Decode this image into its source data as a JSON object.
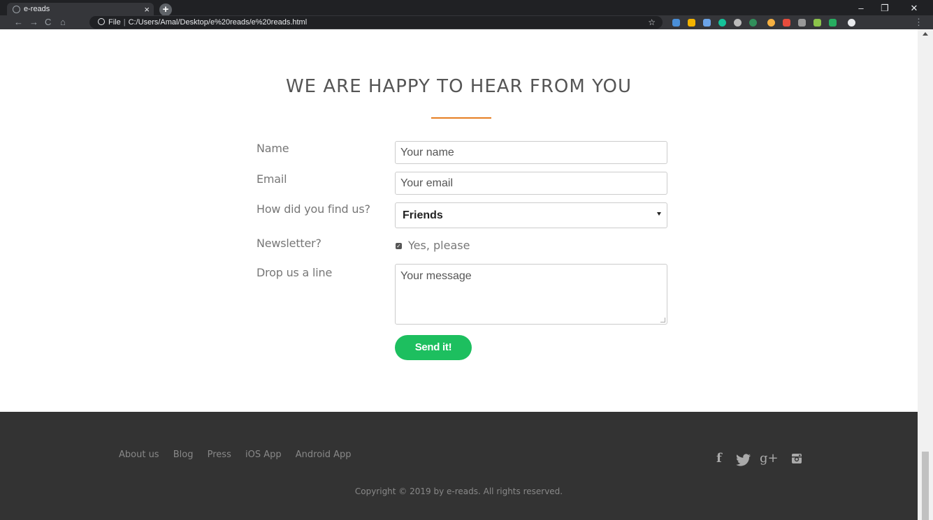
{
  "browser": {
    "tab_title": "e-reads",
    "tab_close": "×",
    "new_tab": "+",
    "url_prefix": "File",
    "url_separator": "|",
    "url": "C:/Users/Amal/Desktop/e%20reads/e%20reads.html",
    "star": "☆",
    "window_minimize": "–",
    "window_restore": "❐",
    "window_close": "✕",
    "nav_back": "←",
    "nav_forward": "→",
    "nav_reload": "C",
    "nav_home": "⌂",
    "menu": "⋮"
  },
  "form": {
    "heading": "WE ARE HAPPY TO HEAR FROM YOU",
    "accent_color": "#e67e22",
    "name_label": "Name",
    "name_placeholder": "Your name",
    "email_label": "Email",
    "email_placeholder": "Your email",
    "find_label": "How did you find us?",
    "find_selected": "Friends",
    "newsletter_label": "Newsletter?",
    "newsletter_checked": true,
    "newsletter_option": "Yes, please",
    "message_label": "Drop us a line",
    "message_placeholder": "Your message",
    "submit_label": "Send it!",
    "submit_color": "#1dbf5f"
  },
  "footer": {
    "nav": [
      "About us",
      "Blog",
      "Press",
      "iOS App",
      "Android App"
    ],
    "social": [
      {
        "icon": "facebook-icon",
        "glyph": "f"
      },
      {
        "icon": "twitter-icon",
        "glyph": "🐦"
      },
      {
        "icon": "google-plus-icon",
        "glyph": "g+"
      },
      {
        "icon": "instagram-icon",
        "glyph": "◙"
      }
    ],
    "copyright": "Copyright © 2019 by e-reads. All rights reserved."
  }
}
